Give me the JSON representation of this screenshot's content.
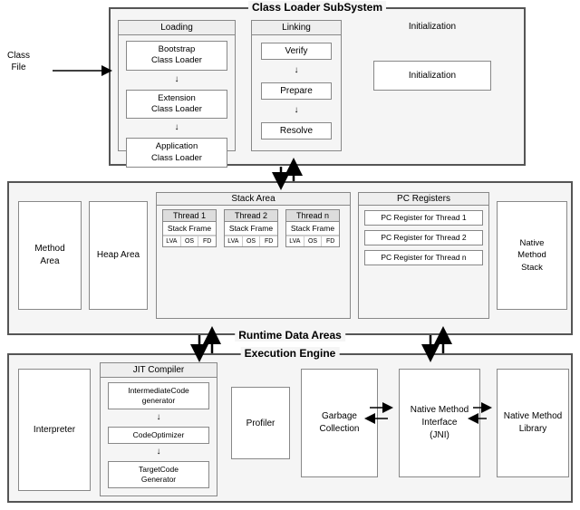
{
  "diagram": {
    "classLoaderSubsystem": {
      "title": "Class Loader SubSystem",
      "loading": {
        "title": "Loading",
        "loaders": [
          "Bootstrap\nClass Loader",
          "Extension\nClass Loader",
          "Application\nClass Loader"
        ]
      },
      "linking": {
        "title": "Linking",
        "steps": [
          "Verify",
          "Prepare",
          "Resolve"
        ]
      },
      "initialization": {
        "title": "Initialization",
        "label": "Initialization"
      }
    },
    "classFile": {
      "line1": "Class",
      "line2": "File"
    },
    "runtimeDataAreas": {
      "title": "Runtime Data Areas",
      "methodArea": "Method\nArea",
      "heapArea": "Heap Area",
      "stackArea": {
        "title": "Stack Area",
        "threads": [
          {
            "label": "Thread 1"
          },
          {
            "label": "Thread 2"
          },
          {
            "label": "Thread n"
          }
        ],
        "stackFrame": "Stack Frame",
        "cells": [
          "LVA",
          "OS",
          "FD"
        ]
      },
      "pcRegisters": {
        "title": "PC Registers",
        "items": [
          "PC Register for Thread 1",
          "PC Register for Thread 2",
          "PC Register for Thread n"
        ]
      },
      "nativeMethodStack": "Native\nMethod\nStack"
    },
    "executionEngine": {
      "title": "Execution Engine",
      "interpreter": "Interpreter",
      "jitCompiler": {
        "title": "JIT Compiler",
        "boxes": [
          "IntermediateCode\ngenerator",
          "CodeOptimizer",
          "TargetCode\nGenerator"
        ]
      },
      "profiler": "Profiler",
      "garbageCollection": "Garbage\nCollection",
      "nativeMethodInterface": "Native Method\nInterface\n(JNI)",
      "nativeMethodLibrary": "Native Method\nLibrary"
    }
  }
}
